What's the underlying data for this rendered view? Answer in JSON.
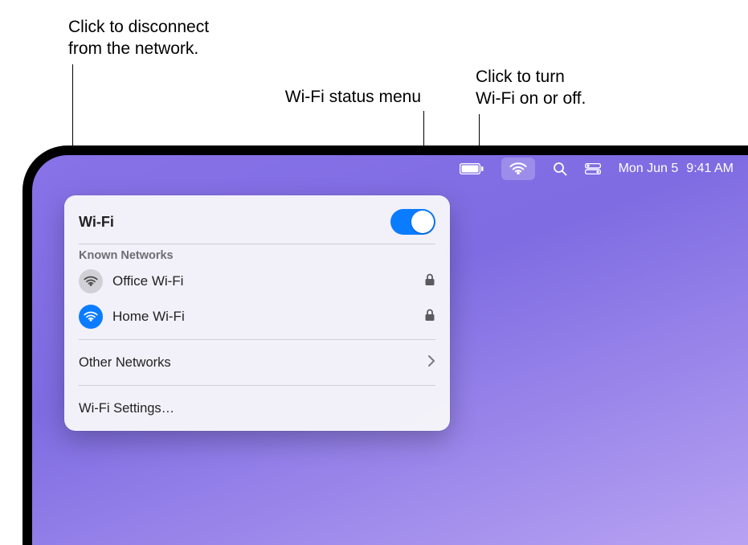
{
  "callouts": {
    "disconnect": "Click to disconnect\nfrom the network.",
    "status_menu": "Wi-Fi status menu",
    "toggle": "Click to turn\nWi-Fi on or off."
  },
  "menubar": {
    "date": "Mon Jun 5",
    "time": "9:41 AM"
  },
  "panel": {
    "title": "Wi-Fi",
    "wifi_on": true,
    "known_header": "Known Networks",
    "networks": [
      {
        "name": "Office Wi-Fi",
        "secured": true,
        "connected": false
      },
      {
        "name": "Home Wi-Fi",
        "secured": true,
        "connected": true
      }
    ],
    "other_label": "Other Networks",
    "settings_label": "Wi-Fi Settings…"
  }
}
